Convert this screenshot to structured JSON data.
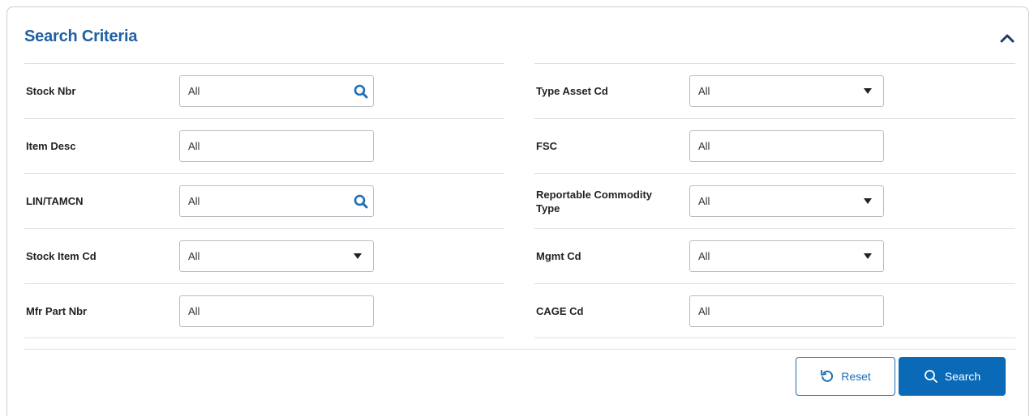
{
  "panel": {
    "title": "Search Criteria"
  },
  "left_fields": [
    {
      "label": "Stock Nbr",
      "value": "All",
      "control": "search"
    },
    {
      "label": "Item Desc",
      "value": "All",
      "control": "text"
    },
    {
      "label": "LIN/TAMCN",
      "value": "All",
      "control": "search"
    },
    {
      "label": "Stock Item Cd",
      "value": "All",
      "control": "select"
    },
    {
      "label": "Mfr Part Nbr",
      "value": "All",
      "control": "text"
    }
  ],
  "right_fields": [
    {
      "label": "Type Asset Cd",
      "value": "All",
      "control": "select"
    },
    {
      "label": "FSC",
      "value": "All",
      "control": "text"
    },
    {
      "label": "Reportable Commodity Type",
      "value": "All",
      "control": "select"
    },
    {
      "label": "Mgmt Cd",
      "value": "All",
      "control": "select"
    },
    {
      "label": "CAGE Cd",
      "value": "All",
      "control": "text"
    }
  ],
  "buttons": {
    "reset_label": "Reset",
    "search_label": "Search"
  },
  "colors": {
    "accent": "#1f5fa3",
    "primary_button": "#0a6ab7",
    "border": "#dcdfe3"
  }
}
